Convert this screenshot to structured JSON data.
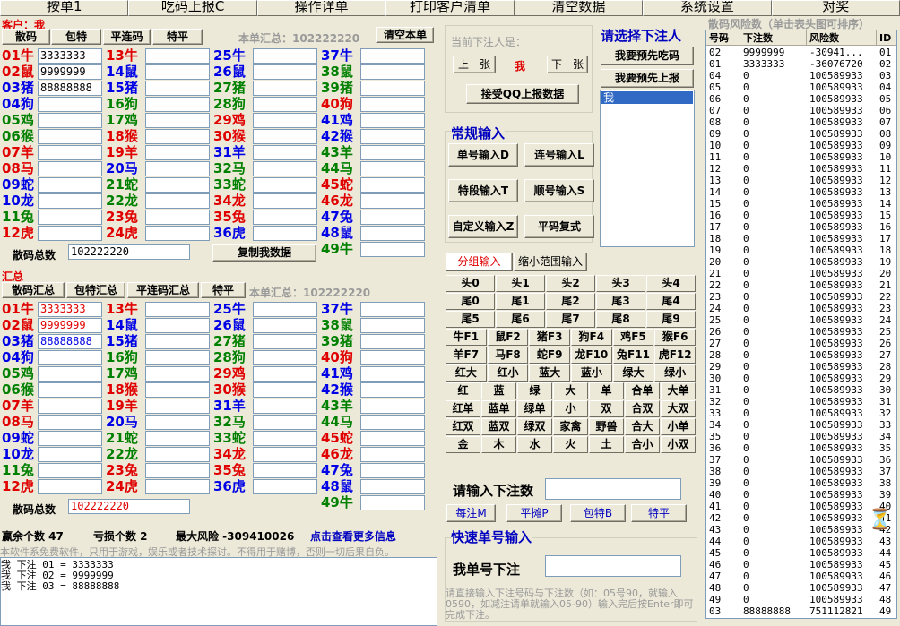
{
  "tabs": [
    "按单1",
    "吃码上报C",
    "操作详单",
    "打印客户清单",
    "清空数据",
    "系统设置",
    "对奖"
  ],
  "customer_label": "客户：我",
  "top_tools": [
    "散码",
    "包特",
    "平连码",
    "特平"
  ],
  "top_total_text": "本单汇总：102222220",
  "clear_order": "清空本单",
  "summary_label": "汇总",
  "bottom_tools": [
    "散码汇总",
    "包特汇总",
    "平连码汇总",
    "特平"
  ],
  "bottom_total_text": "本单汇总：102222220",
  "sancode_total_label": "散码总数",
  "top_sancode_total": "102222220",
  "bottom_sancode_total": "102222220",
  "copy_my_data": "复制我数据",
  "numbers": [
    [
      "01",
      "牛",
      "red"
    ],
    [
      "02",
      "鼠",
      "red"
    ],
    [
      "03",
      "猪",
      "blue"
    ],
    [
      "04",
      "狗",
      "blue"
    ],
    [
      "05",
      "鸡",
      "green"
    ],
    [
      "06",
      "猴",
      "green"
    ],
    [
      "07",
      "羊",
      "red"
    ],
    [
      "08",
      "马",
      "red"
    ],
    [
      "09",
      "蛇",
      "blue"
    ],
    [
      "10",
      "龙",
      "blue"
    ],
    [
      "11",
      "兔",
      "green"
    ],
    [
      "12",
      "虎",
      "red"
    ],
    [
      "13",
      "牛",
      "red"
    ],
    [
      "14",
      "鼠",
      "blue"
    ],
    [
      "15",
      "猪",
      "blue"
    ],
    [
      "16",
      "狗",
      "green"
    ],
    [
      "17",
      "鸡",
      "green"
    ],
    [
      "18",
      "猴",
      "red"
    ],
    [
      "19",
      "羊",
      "red"
    ],
    [
      "20",
      "马",
      "blue"
    ],
    [
      "21",
      "蛇",
      "green"
    ],
    [
      "22",
      "龙",
      "green"
    ],
    [
      "23",
      "兔",
      "red"
    ],
    [
      "24",
      "虎",
      "red"
    ],
    [
      "25",
      "牛",
      "blue"
    ],
    [
      "26",
      "鼠",
      "blue"
    ],
    [
      "27",
      "猪",
      "green"
    ],
    [
      "28",
      "狗",
      "green"
    ],
    [
      "29",
      "鸡",
      "red"
    ],
    [
      "30",
      "猴",
      "red"
    ],
    [
      "31",
      "羊",
      "blue"
    ],
    [
      "32",
      "马",
      "green"
    ],
    [
      "33",
      "蛇",
      "green"
    ],
    [
      "34",
      "龙",
      "red"
    ],
    [
      "35",
      "兔",
      "red"
    ],
    [
      "36",
      "虎",
      "blue"
    ],
    [
      "37",
      "牛",
      "blue"
    ],
    [
      "38",
      "鼠",
      "green"
    ],
    [
      "39",
      "猪",
      "green"
    ],
    [
      "40",
      "狗",
      "red"
    ],
    [
      "41",
      "鸡",
      "blue"
    ],
    [
      "42",
      "猴",
      "blue"
    ],
    [
      "43",
      "羊",
      "green"
    ],
    [
      "44",
      "马",
      "green"
    ],
    [
      "45",
      "蛇",
      "red"
    ],
    [
      "46",
      "龙",
      "red"
    ],
    [
      "47",
      "兔",
      "blue"
    ],
    [
      "48",
      "鼠",
      "blue"
    ]
  ],
  "n49": [
    "49",
    "牛",
    "green"
  ],
  "top_inputs": {
    "01": "3333333",
    "02": "9999999",
    "03": "88888888"
  },
  "bottom_inputs": {
    "01": "3333333",
    "02": "9999999",
    "03": "88888888"
  },
  "current_bet_label": "当前下注人是：",
  "prev_btn": "上一张",
  "current_person": "我",
  "next_btn": "下一张",
  "qq_btn": "接受QQ上报数据",
  "choose_label": "请选择下注人",
  "pre_eat_btn": "我要预先吃码",
  "pre_report_btn": "我要预先上报",
  "person_list": [
    "我"
  ],
  "regular_title": "常规输入",
  "regular_btns": [
    "单号输入D",
    "连号输入L",
    "特段输入T",
    "顺号输入S",
    "自定义输入Z",
    "平码复式"
  ],
  "group_tabs": [
    "分组输入",
    "缩小范围输入"
  ],
  "keypad": [
    [
      "头0",
      "头1",
      "头2",
      "头3",
      "头4"
    ],
    [
      "尾0",
      "尾1",
      "尾2",
      "尾3",
      "尾4"
    ],
    [
      "尾5",
      "尾6",
      "尾7",
      "尾8",
      "尾9"
    ],
    [
      "牛F1",
      "鼠F2",
      "猪F3",
      "狗F4",
      "鸡F5",
      "猴F6"
    ],
    [
      "羊F7",
      "马F8",
      "蛇F9",
      "龙F10",
      "兔F11",
      "虎F12"
    ],
    [
      "红大",
      "红小",
      "蓝大",
      "蓝小",
      "绿大",
      "绿小"
    ],
    [
      "红",
      "蓝",
      "绿",
      "大",
      "单",
      "合单",
      "大单"
    ],
    [
      "红单",
      "蓝单",
      "绿单",
      "小",
      "双",
      "合双",
      "大双"
    ],
    [
      "红双",
      "蓝双",
      "绿双",
      "家禽",
      "野兽",
      "合大",
      "小单"
    ],
    [
      "金",
      "木",
      "水",
      "火",
      "土",
      "合小",
      "小双"
    ]
  ],
  "bet_input_label": "请输入下注数",
  "bet_btns": [
    "每注M",
    "平摊P",
    "包特B",
    "特平"
  ],
  "quick_title": "快速单号输入",
  "my_single_label": "我单号下注",
  "hint_text": "请直接输入下注号码与下注数（如：05号90，就输入0590，如减注请单就输入05-90）输入完后按Enter即可完成下注。",
  "stats": {
    "win": "赢余个数 47",
    "loss": "亏损个数 2",
    "risk": "最大风险 -309410026",
    "more": "点击查看更多信息"
  },
  "disclaimer": "本软件系免费软件，只用于游戏，娱乐或者技术探讨。不得用于赌博，否则一切后果自负。",
  "log": [
    "我 下注 01 = 3333333",
    "我 下注 02 = 9999999",
    "我 下注 03 = 88888888"
  ],
  "risk_title": "散码风险数（单击表头图可排序）",
  "risk_headers": [
    "号码",
    "下注数",
    "风险数",
    "ID"
  ],
  "risk_rows": [
    [
      "02",
      "9999999",
      "-30941...",
      "01"
    ],
    [
      "01",
      "3333333",
      "-36076720",
      "02"
    ],
    [
      "04",
      "0",
      "100589933",
      "03"
    ],
    [
      "05",
      "0",
      "100589933",
      "04"
    ],
    [
      "06",
      "0",
      "100589933",
      "05"
    ],
    [
      "07",
      "0",
      "100589933",
      "06"
    ],
    [
      "08",
      "0",
      "100589933",
      "07"
    ],
    [
      "09",
      "0",
      "100589933",
      "08"
    ],
    [
      "10",
      "0",
      "100589933",
      "09"
    ],
    [
      "11",
      "0",
      "100589933",
      "10"
    ],
    [
      "12",
      "0",
      "100589933",
      "11"
    ],
    [
      "13",
      "0",
      "100589933",
      "12"
    ],
    [
      "14",
      "0",
      "100589933",
      "13"
    ],
    [
      "15",
      "0",
      "100589933",
      "14"
    ],
    [
      "16",
      "0",
      "100589933",
      "15"
    ],
    [
      "17",
      "0",
      "100589933",
      "16"
    ],
    [
      "18",
      "0",
      "100589933",
      "17"
    ],
    [
      "19",
      "0",
      "100589933",
      "18"
    ],
    [
      "20",
      "0",
      "100589933",
      "19"
    ],
    [
      "21",
      "0",
      "100589933",
      "20"
    ],
    [
      "22",
      "0",
      "100589933",
      "21"
    ],
    [
      "23",
      "0",
      "100589933",
      "22"
    ],
    [
      "24",
      "0",
      "100589933",
      "23"
    ],
    [
      "25",
      "0",
      "100589933",
      "24"
    ],
    [
      "26",
      "0",
      "100589933",
      "25"
    ],
    [
      "27",
      "0",
      "100589933",
      "26"
    ],
    [
      "28",
      "0",
      "100589933",
      "27"
    ],
    [
      "29",
      "0",
      "100589933",
      "28"
    ],
    [
      "30",
      "0",
      "100589933",
      "29"
    ],
    [
      "31",
      "0",
      "100589933",
      "30"
    ],
    [
      "32",
      "0",
      "100589933",
      "31"
    ],
    [
      "33",
      "0",
      "100589933",
      "32"
    ],
    [
      "34",
      "0",
      "100589933",
      "33"
    ],
    [
      "35",
      "0",
      "100589933",
      "34"
    ],
    [
      "36",
      "0",
      "100589933",
      "35"
    ],
    [
      "37",
      "0",
      "100589933",
      "36"
    ],
    [
      "38",
      "0",
      "100589933",
      "37"
    ],
    [
      "39",
      "0",
      "100589933",
      "38"
    ],
    [
      "40",
      "0",
      "100589933",
      "39"
    ],
    [
      "41",
      "0",
      "100589933",
      "40"
    ],
    [
      "42",
      "0",
      "100589933",
      "41"
    ],
    [
      "43",
      "0",
      "100589933",
      "42"
    ],
    [
      "44",
      "0",
      "100589933",
      "43"
    ],
    [
      "45",
      "0",
      "100589933",
      "44"
    ],
    [
      "46",
      "0",
      "100589933",
      "45"
    ],
    [
      "47",
      "0",
      "100589933",
      "46"
    ],
    [
      "48",
      "0",
      "100589933",
      "47"
    ],
    [
      "49",
      "0",
      "100589933",
      "48"
    ],
    [
      "03",
      "88888888",
      "751112821",
      "49"
    ]
  ],
  "colors": {
    "red": "#e00000",
    "blue": "#0000e6",
    "green": "#008000",
    "navy": "#0000c0"
  }
}
